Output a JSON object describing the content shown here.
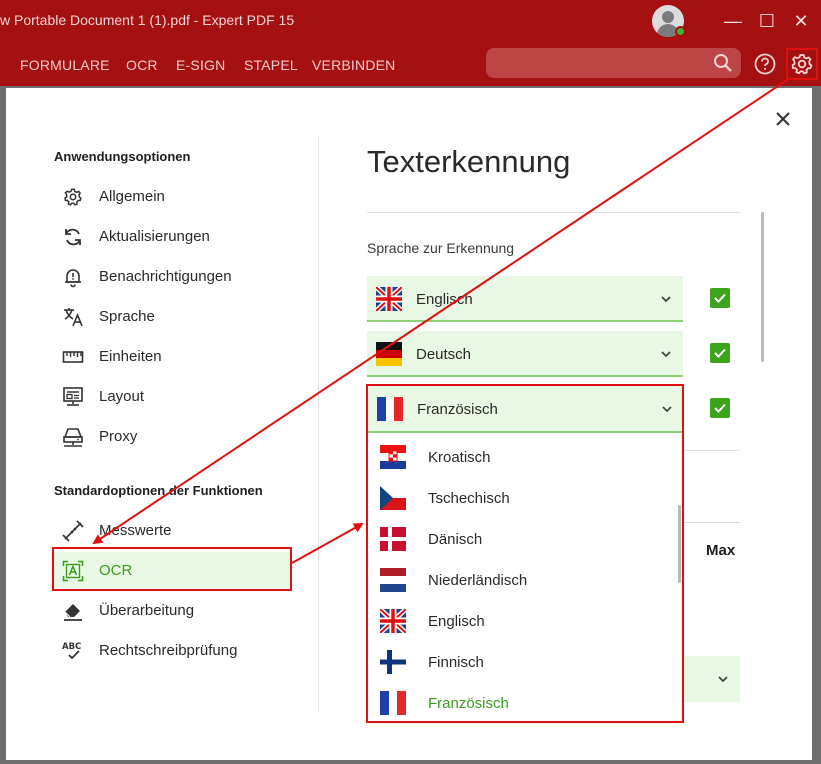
{
  "window": {
    "title": "w Portable Document 1 (1).pdf   -   Expert PDF 15",
    "minimize": "—",
    "maximize": "☐",
    "close": "✕"
  },
  "ribbon": {
    "tabs": [
      "FORMULARE",
      "OCR",
      "E-SIGN",
      "STAPEL",
      "VERBINDEN"
    ],
    "search_value": ""
  },
  "sidebar": {
    "section1_title": "Anwendungsoptionen",
    "section1_items": [
      {
        "label": "Allgemein",
        "icon": "gear-icon"
      },
      {
        "label": "Aktualisierungen",
        "icon": "refresh-icon"
      },
      {
        "label": "Benachrichtigungen",
        "icon": "bell-icon"
      },
      {
        "label": "Sprache",
        "icon": "translate-icon"
      },
      {
        "label": "Einheiten",
        "icon": "ruler-icon"
      },
      {
        "label": "Layout",
        "icon": "layout-icon"
      },
      {
        "label": "Proxy",
        "icon": "network-icon"
      }
    ],
    "section2_title": "Standardoptionen der Funktionen",
    "section2_items": [
      {
        "label": "Messwerte",
        "icon": "measure-icon"
      },
      {
        "label": "OCR",
        "icon": "ocr-icon",
        "active": true
      },
      {
        "label": "Überarbeitung",
        "icon": "eraser-icon"
      },
      {
        "label": "Rechtschreibprüfung",
        "icon": "spellcheck-icon"
      }
    ]
  },
  "main": {
    "title": "Texterkennung",
    "section_label": "Sprache zur Erkennung",
    "languages": [
      {
        "label": "Englisch",
        "flag": "flag-uk",
        "checked": true
      },
      {
        "label": "Deutsch",
        "flag": "flag-de",
        "checked": true
      },
      {
        "label": "Französisch",
        "flag": "flag-fr",
        "checked": true
      }
    ],
    "dropdown_options": [
      {
        "label": "Kroatisch",
        "flag": "flag-hr"
      },
      {
        "label": "Tschechisch",
        "flag": "flag-cz"
      },
      {
        "label": "Dänisch",
        "flag": "flag-dk"
      },
      {
        "label": "Niederländisch",
        "flag": "flag-nl"
      },
      {
        "label": "Englisch",
        "flag": "flag-uk"
      },
      {
        "label": "Finnisch",
        "flag": "flag-fi"
      },
      {
        "label": "Französisch",
        "flag": "flag-fr",
        "selected": true
      }
    ],
    "partial_label": "Max"
  },
  "colors": {
    "brand_red": "#a51010",
    "accent_green": "#3ca31d",
    "highlight_red": "#e01010",
    "active_bg": "#e9f8e4"
  }
}
